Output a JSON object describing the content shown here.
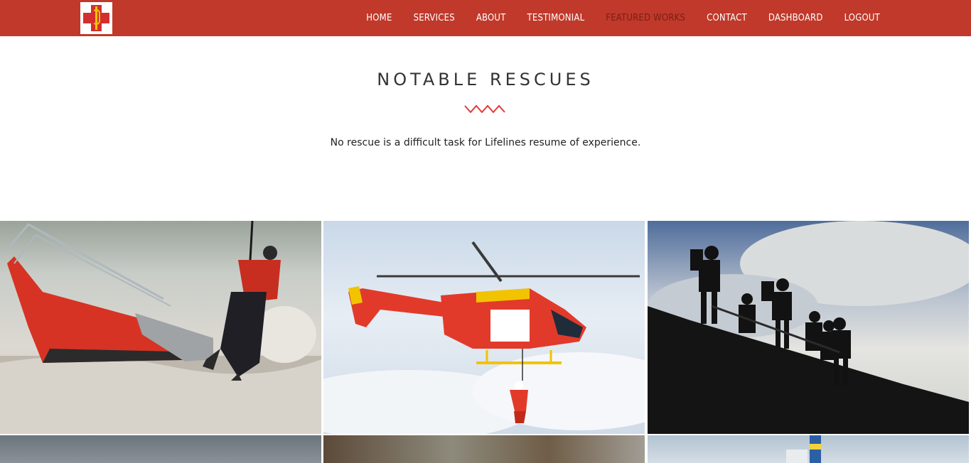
{
  "nav": {
    "items": [
      "HOME",
      "SERVICES",
      "ABOUT",
      "TESTIMONIAL",
      "FEATURED WORKS",
      "CONTACT",
      "DASHBOARD",
      "LOGOUT"
    ],
    "active": "FEATURED WORKS"
  },
  "section": {
    "title": "NOTABLE RESCUES",
    "tagline": "No rescue is a difficult task for Lifelines resume of experience."
  },
  "colors": {
    "brand": "#c0392b",
    "accent_zigzag": "#e03a3a"
  },
  "gallery": {
    "items": [
      "boat-water-rescue-photo",
      "helicopter-rescue-photo",
      "mountain-team-silhouette-photo",
      "gallery-photo-4",
      "gallery-photo-5",
      "gallery-photo-6"
    ]
  }
}
